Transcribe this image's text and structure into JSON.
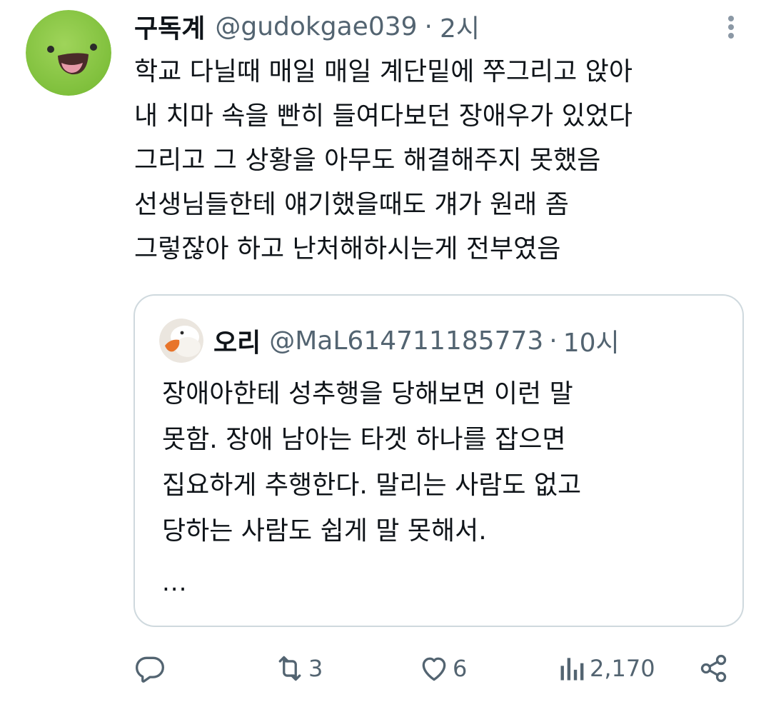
{
  "tweet": {
    "display_name": "구독계",
    "handle": "@gudokgae039",
    "separator": "·",
    "time": "2시",
    "text_lines": [
      "학교 다닐때 매일 매일 계단밑에 쭈그리고 앉아",
      "내 치마 속을 빤히 들여다보던 장애우가 있었다",
      "그리고 그 상황을 아무도 해결해주지 못했음",
      "선생님들한테 얘기했을때도 걔가 원래 좀",
      "그렇잖아 하고 난처해하시는게 전부였음"
    ]
  },
  "quote": {
    "display_name": "오리",
    "handle": "@MaL614711185773",
    "separator": "·",
    "time": "10시",
    "text_lines": [
      "장애아한테 성추행을 당해보면 이런 말",
      "못함. 장애 남아는 타겟 하나를 잡으면",
      "집요하게 추행한다. 말리는 사람도 없고",
      "당하는 사람도 쉽게 말 못해서."
    ],
    "more": "..."
  },
  "actions": {
    "reply_icon": "reply-icon",
    "retweet_icon": "retweet-icon",
    "retweet_count": "3",
    "like_icon": "heart-icon",
    "like_count": "6",
    "views_icon": "views-icon",
    "views_count": "2,170",
    "share_icon": "share-icon"
  },
  "colors": {
    "text_primary": "#0f1419",
    "text_secondary": "#536471",
    "border": "#cfd9de",
    "avatar_green": "#86c63f"
  }
}
